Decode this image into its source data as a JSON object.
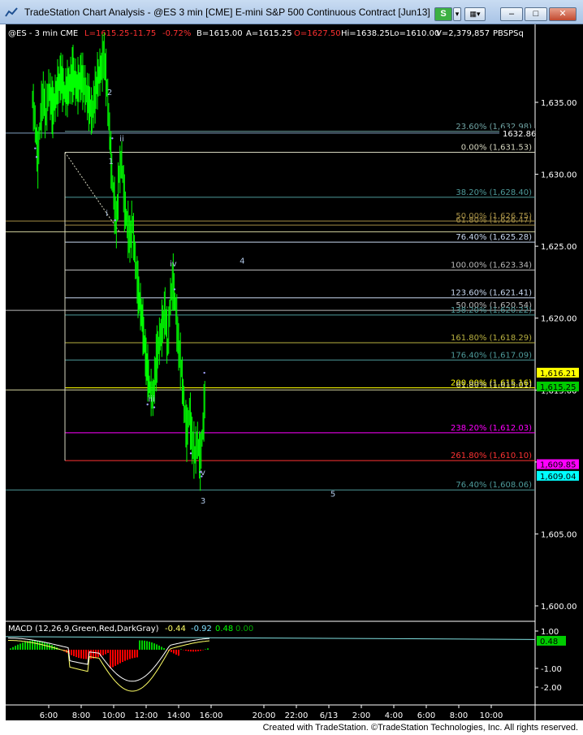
{
  "window": {
    "title": "TradeStation Chart Analysis - @ES 3 min [CME] E-mini S&P 500 Continuous Contract [Jun13]",
    "s_button": "S",
    "menu_glyph": "▾",
    "minimize": "–",
    "maximize": "□",
    "close": "✕"
  },
  "header": {
    "symbol": "@ES - 3 min  CME",
    "last": "L=1615.25",
    "net_change": "-11.75",
    "pct_change": "-0.72%",
    "bid": "B=1615.00",
    "ask": "A=1615.25",
    "open": "O=1627.50",
    "high": "Hi=1638.25",
    "low": "Lo=1610.00",
    "volume": "V=2,379,857",
    "tag": "PBSPSq"
  },
  "price_axis": {
    "labels": [
      {
        "text": "1,635.00",
        "price": 1635
      },
      {
        "text": "1,630.00",
        "price": 1630
      },
      {
        "text": "1,625.00",
        "price": 1625
      },
      {
        "text": "1,620.00",
        "price": 1620
      },
      {
        "text": "1,615.00",
        "price": 1615
      },
      {
        "text": "1,610.00",
        "price": 1610
      },
      {
        "text": "1,605.00",
        "price": 1605
      },
      {
        "text": "1,600.00",
        "price": 1600
      }
    ],
    "markers": [
      {
        "text": "1632.86",
        "price": 1632.86,
        "bg": "#000000",
        "fg": "#ffffff",
        "target": "left"
      },
      {
        "text": "1,616.21",
        "price": 1616.21,
        "bg": "#ffff00",
        "fg": "#000000",
        "target": "axis"
      },
      {
        "text": "1,615.25",
        "price": 1615.25,
        "bg": "#00cc00",
        "fg": "#000000",
        "target": "axis"
      },
      {
        "text": "1,609.85",
        "price": 1609.85,
        "bg": "#ff00ff",
        "fg": "#000000",
        "target": "axis"
      },
      {
        "text": "1,609.04",
        "price": 1609.04,
        "bg": "#00ffff",
        "fg": "#000000",
        "target": "axis"
      }
    ]
  },
  "time_axis": {
    "labels": [
      "6:00",
      "8:00",
      "10:00",
      "12:00",
      "14:00",
      "16:00",
      "20:00",
      "22:00",
      "6/13",
      "2:00",
      "4:00",
      "6:00",
      "8:00",
      "10:00"
    ]
  },
  "fib_levels": [
    {
      "label": "23.60% (1,632.98)",
      "price": 1632.98,
      "color": "#6fa3a3"
    },
    {
      "label": "0.00% (1,631.53)",
      "price": 1631.53,
      "color": "#d6d6c0"
    },
    {
      "label": "38.20% (1,628.40)",
      "price": 1628.4,
      "color": "#4e9a9a"
    },
    {
      "label": "50.00% (1,626.75)",
      "price": 1626.75,
      "color": "#a38d45"
    },
    {
      "label": "61.80% (1,626.47)",
      "price": 1626.47,
      "color": "#a38d45"
    },
    {
      "label": "76.40% (1,625.28)",
      "price": 1625.28,
      "color": "#c8d8f0"
    },
    {
      "label": "100.00% (1,623.34)",
      "price": 1623.34,
      "color": "#b8b8b8"
    },
    {
      "label": "123.60% (1,621.41)",
      "price": 1621.41,
      "color": "#c8d8f0"
    },
    {
      "label": "50.00% (1,620.54)",
      "price": 1620.54,
      "color": "#b8b8b8"
    },
    {
      "label": "138.20% (1,620.22)",
      "price": 1620.22,
      "color": "#4e9a9a"
    },
    {
      "label": "161.80% (1,618.29)",
      "price": 1618.29,
      "color": "#b8b040"
    },
    {
      "label": "176.40% (1,617.09)",
      "price": 1617.09,
      "color": "#4e9a9a"
    },
    {
      "label": "200.00% (1,615.16)",
      "price": 1615.16,
      "color": "#ffff00"
    },
    {
      "label": "61.80% (1,615.01)",
      "price": 1615.01,
      "color": "#d6d6a0"
    },
    {
      "label": "238.20% (1,612.03)",
      "price": 1612.03,
      "color": "#ff00ff"
    },
    {
      "label": "261.80% (1,610.10)",
      "price": 1610.1,
      "color": "#ff3333"
    },
    {
      "label": "76.40% (1,608.06)",
      "price": 1608.06,
      "color": "#4e9a9a"
    }
  ],
  "wave_labels": [
    {
      "text": "2",
      "x_time": "9:45",
      "price": 1635.5
    },
    {
      "text": "ii",
      "x_time": "10:30",
      "price": 1632.3
    },
    {
      "text": "1",
      "x_time": "9:50",
      "price": 1630.7
    },
    {
      "text": "i",
      "x_time": "9:35",
      "price": 1627.1
    },
    {
      "text": "iv",
      "x_time": "13:40",
      "price": 1623.6
    },
    {
      "text": "4",
      "x_time": "17:55",
      "price": 1623.8
    },
    {
      "text": "iii",
      "x_time": "12:20",
      "price": 1614.2
    },
    {
      "text": "v",
      "x_time": "15:30",
      "price": 1609.1
    },
    {
      "text": "3",
      "x_time": "15:30",
      "price": 1607.1
    },
    {
      "text": "5",
      "x_time": "23:30",
      "price": 1607.6
    }
  ],
  "macd": {
    "title": "MACD (12,26,9,Green,Red,DarkGray)",
    "macd_value": "-0.44",
    "signal_value": "-0.92",
    "hist_value": "0.48",
    "extra_value": "0.00",
    "axis_labels": [
      {
        "text": "1.00",
        "value": 1.0
      },
      {
        "text": "-1.00",
        "value": -1.0
      },
      {
        "text": "-2.00",
        "value": -2.0
      }
    ],
    "marker": {
      "text": "0.48",
      "value": 0.48
    }
  },
  "footer": {
    "text": "Created with TradeStation. ©TradeStation Technologies, Inc. All rights reserved."
  },
  "colors": {
    "background": "#000000",
    "price_bars": "#00ff00",
    "axis_text": "#ffffff",
    "header_label": "#ffffff",
    "header_red": "#ff3030",
    "header_cyan": "#00ffff",
    "macd_line": "#ffff66",
    "macd_signal": "#ffffff",
    "hist_pos": "#00cc00",
    "hist_neg": "#ff0000",
    "trendline": "#80e0e0"
  }
}
